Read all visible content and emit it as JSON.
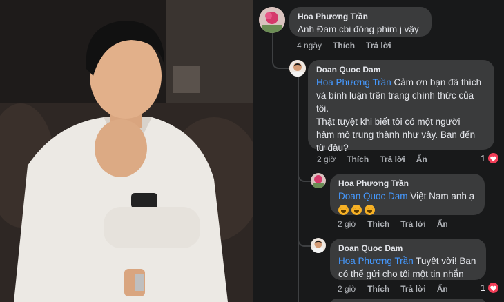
{
  "comments": [
    {
      "author": "Hoa Phương Trần",
      "text": "Anh Đam cbi đóng phim j vậy",
      "actions": {
        "time": "4 ngày",
        "like": "Thích",
        "reply": "Trả lời"
      }
    },
    {
      "author": "Doan Quoc Dam",
      "mention": "Hoa Phương Trần",
      "line1": "Cảm ơn bạn đã thích",
      "line2": "và bình luận trên trang chính thức của",
      "line3": "tôi.",
      "line4": "Thật tuyệt khi biết tôi có một người",
      "line5": "hâm mộ trung thành như vậy. Bạn đến",
      "line6": "từ đâu?",
      "actions": {
        "time": "2 giờ",
        "like": "Thích",
        "reply": "Trả lời",
        "hide": "Ẩn"
      },
      "reaction_count": "1"
    },
    {
      "author": "Hoa Phương Trần",
      "mention": "Doan Quoc Dam",
      "text": "Việt Nam anh ạ",
      "actions": {
        "time": "2 giờ",
        "like": "Thích",
        "reply": "Trả lời",
        "hide": "Ẩn"
      }
    },
    {
      "author": "Doan Quoc Dam",
      "mention": "Hoa Phương Trần",
      "line1": "Tuyệt vời! Bạn",
      "line2": "có thể gửi cho tôi một tin nhắn",
      "actions": {
        "time": "2 giờ",
        "like": "Thích",
        "reply": "Trả lời",
        "hide": "Ẩn"
      },
      "reaction_count": "1"
    }
  ],
  "colors": {
    "background": "#18191a",
    "bubble": "#3a3b3c",
    "mention": "#4599ff",
    "heart": "#f33e58"
  },
  "icons": {
    "reaction": "heart-icon",
    "emoji": "rolling-laughing-emoji-icon"
  }
}
